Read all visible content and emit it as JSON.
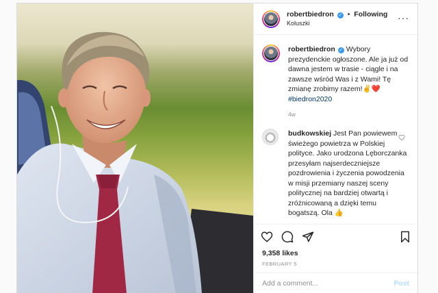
{
  "post": {
    "author": "robertbiedron",
    "following_label": "Following",
    "location": "Koluszki",
    "caption": "Wybory prezydenckie ogłoszone. Ale ja już od dawna jestem w trasie - ciągle i na zawsze wśród Was i z Wami! Tę zmianę zrobimy razem!✌️❤️",
    "hashtag": "#biedron2020",
    "time_ago": "4w",
    "likes": "9,358 likes",
    "date": "FEBRUARY 5"
  },
  "comment": {
    "author": "budkowskiej",
    "text": "Jest Pan powiewem świeżego powietrza w Polskiej polityce. Jako urodzona Lęborczanka przesyłam najserdeczniejsze pozdrowienia i życzenia powodzenia w misji przemiany naszej sceny politycznej na bardziej otwartą i zróżnicowaną a dzięki temu bogatszą. Ola 👍"
  },
  "add_comment": {
    "placeholder": "Add a comment...",
    "post_label": "Post"
  },
  "icons": {
    "verified": "verified-badge-icon",
    "more": "more-options-icon",
    "like": "heart-icon",
    "comment": "comment-bubble-icon",
    "share": "paper-plane-icon",
    "save": "bookmark-icon"
  },
  "colors": {
    "verified": "#3897f0",
    "post_button": "#b2dffc",
    "hashtag": "#00376b",
    "muted": "#8e8e8e"
  }
}
